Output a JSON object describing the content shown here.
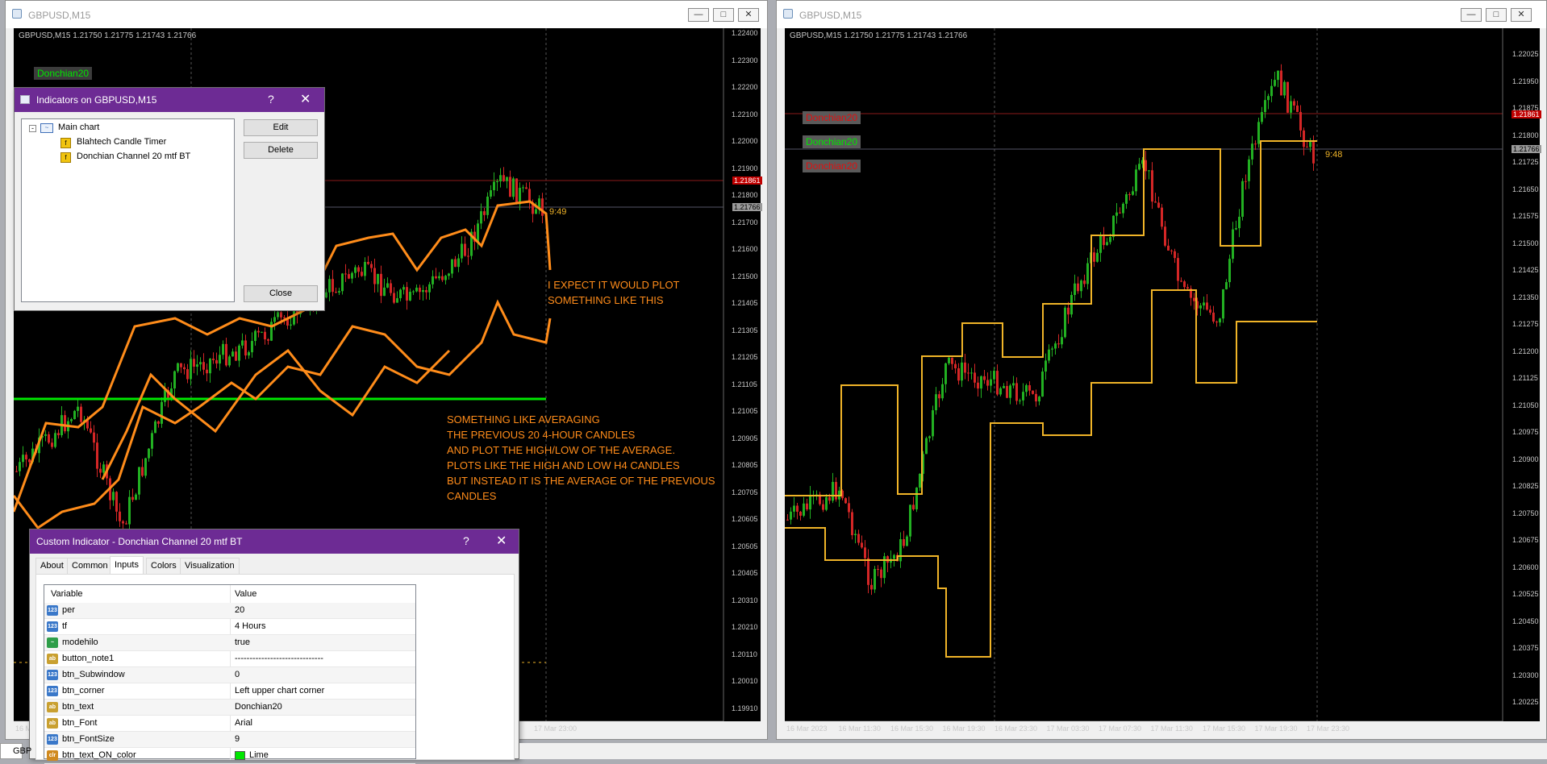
{
  "left_window": {
    "title": "GBPUSD,M15",
    "ohlc": "GBPUSD,M15  1.21750 1.21775 1.21743 1.21766",
    "price_axis": [
      "1.22400",
      "1.22300",
      "1.22200",
      "1.22100",
      "1.22000",
      "1.21900",
      "1.21800",
      "1.21700",
      "1.21600",
      "1.21500",
      "1.21405",
      "1.21305",
      "1.21205",
      "1.21105",
      "1.21005",
      "1.20905",
      "1.20805",
      "1.20705",
      "1.20605",
      "1.20505",
      "1.20405",
      "1.20310",
      "1.20210",
      "1.20110",
      "1.20010",
      "1.19910"
    ],
    "price_tag_red": "1.21861",
    "price_tag_bid": "1.21766",
    "timer": "9:49",
    "time_axis": [
      "16 M",
      "17 Mar 23:00"
    ],
    "button_tag": "Donchian20",
    "annotation1": "I EXPECT IT WOULD PLOT\nSOMETHING LIKE THIS",
    "annotation2": "SOMETHING LIKE AVERAGING\nTHE PREVIOUS 20 4-HOUR CANDLES\nAND PLOT THE HIGH/LOW OF THE AVERAGE.\nPLOTS LIKE THE HIGH AND LOW H4 CANDLES\nBUT INSTEAD IT IS THE AVERAGE OF THE PREVIOUS\nCANDLES"
  },
  "right_window": {
    "title": "GBPUSD,M15",
    "ohlc": "GBPUSD,M15  1.21750 1.21775 1.21743 1.21766",
    "price_axis": [
      "1.22025",
      "1.21950",
      "1.21875",
      "1.21800",
      "1.21725",
      "1.21650",
      "1.21575",
      "1.21500",
      "1.21425",
      "1.21350",
      "1.21275",
      "1.21200",
      "1.21125",
      "1.21050",
      "1.20975",
      "1.20900",
      "1.20825",
      "1.20750",
      "1.20675",
      "1.20600",
      "1.20525",
      "1.20450",
      "1.20375",
      "1.20300",
      "1.20225"
    ],
    "price_tag_red": "1.21861",
    "price_tag_bid": "1.21766",
    "timer": "9:48",
    "time_axis": [
      "16 Mar 2023",
      "16 Mar 11:30",
      "16 Mar 15:30",
      "16 Mar 19:30",
      "16 Mar 23:30",
      "17 Mar 03:30",
      "17 Mar 07:30",
      "17 Mar 11:30",
      "17 Mar 15:30",
      "17 Mar 19:30",
      "17 Mar 23:30"
    ],
    "button_tags": [
      "Donchian20",
      "Donchian20",
      "Donchian20"
    ]
  },
  "indicators_dialog": {
    "title": "Indicators on GBPUSD,M15",
    "help": "?",
    "close_x": "✕",
    "tree_root": "Main chart",
    "tree_items": [
      "Blahtech Candle Timer",
      "Donchian Channel 20 mtf BT"
    ],
    "edit": "Edit",
    "delete": "Delete",
    "close": "Close"
  },
  "custom_dialog": {
    "title": "Custom Indicator - Donchian Channel 20 mtf BT",
    "help": "?",
    "close_x": "✕",
    "tabs": [
      "About",
      "Common",
      "Inputs",
      "Colors",
      "Visualization"
    ],
    "col_variable": "Variable",
    "col_value": "Value",
    "rows": [
      {
        "icon": "123",
        "name": "per",
        "value": "20"
      },
      {
        "icon": "123",
        "name": "tf",
        "value": "4 Hours"
      },
      {
        "icon": "~",
        "name": "modehilo",
        "value": "true"
      },
      {
        "icon": "ab",
        "name": "button_note1",
        "value": "------------------------------"
      },
      {
        "icon": "123",
        "name": "btn_Subwindow",
        "value": "0"
      },
      {
        "icon": "123",
        "name": "btn_corner",
        "value": "Left upper chart corner"
      },
      {
        "icon": "ab",
        "name": "btn_text",
        "value": "Donchian20"
      },
      {
        "icon": "ab",
        "name": "btn_Font",
        "value": "Arial"
      },
      {
        "icon": "123",
        "name": "btn_FontSize",
        "value": "9"
      },
      {
        "icon": "clr",
        "name": "btn_text_ON_color",
        "value": "Lime"
      }
    ]
  },
  "taskbar_label": "GBP",
  "colors": {
    "bull": "#22b022",
    "bear": "#d42626",
    "donchian_left": "#ff8c1a",
    "donchian_right": "#f0b428",
    "green_line": "#00e600",
    "dialog_title": "#6d2b94"
  }
}
